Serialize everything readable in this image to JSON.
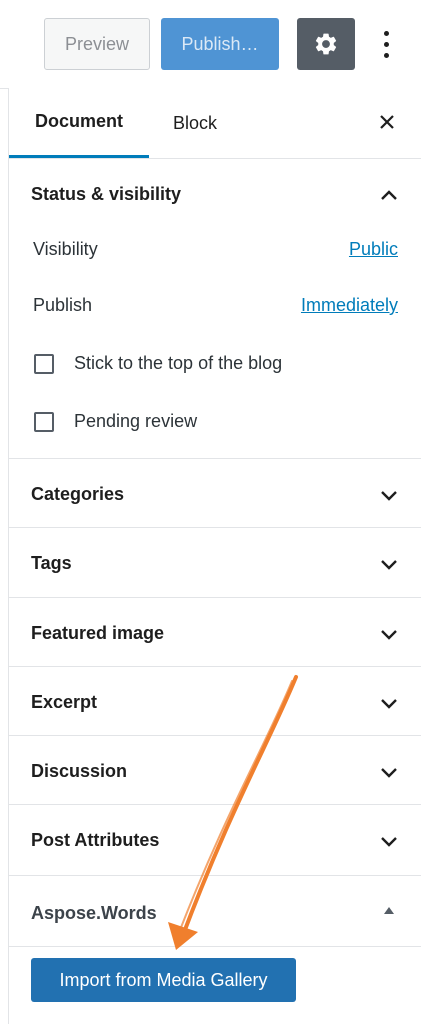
{
  "toolbar": {
    "preview_label": "Preview",
    "publish_label": "Publish…",
    "settings_icon": "gear-icon",
    "more_icon": "vertical-ellipsis-icon"
  },
  "tabs": [
    {
      "label": "Document",
      "active": true
    },
    {
      "label": "Block",
      "active": false
    }
  ],
  "status_panel": {
    "title": "Status & visibility",
    "expanded": true,
    "rows": [
      {
        "label": "Visibility",
        "value": "Public"
      },
      {
        "label": "Publish",
        "value": "Immediately"
      }
    ],
    "checkboxes": [
      {
        "label": "Stick to the top of the blog",
        "checked": false
      },
      {
        "label": "Pending review",
        "checked": false
      }
    ]
  },
  "panels": [
    {
      "title": "Categories"
    },
    {
      "title": "Tags"
    },
    {
      "title": "Featured image"
    },
    {
      "title": "Excerpt"
    },
    {
      "title": "Discussion"
    },
    {
      "title": "Post Attributes"
    }
  ],
  "aspose_panel": {
    "title": "Aspose.Words",
    "expanded": true,
    "button_label": "Import from Media Gallery"
  },
  "colors": {
    "accent": "#007cba",
    "publish_button": "#4f94d4",
    "import_button": "#2271b1",
    "annotation_arrow": "#f07f2d"
  }
}
